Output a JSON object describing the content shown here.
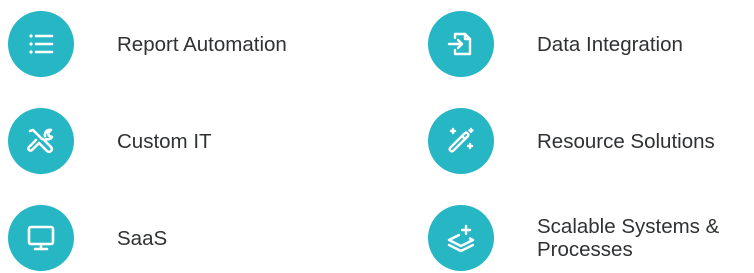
{
  "theme": {
    "accent": "#27b6c4",
    "text": "#2f3133",
    "background": "#ffffff"
  },
  "services": [
    {
      "label": "Report Automation",
      "icon": "list-icon"
    },
    {
      "label": "Data Integration",
      "icon": "import-icon"
    },
    {
      "label": "Custom IT",
      "icon": "tools-icon"
    },
    {
      "label": "Resource Solutions",
      "icon": "magic-wand-icon"
    },
    {
      "label": "SaaS",
      "icon": "monitor-icon"
    },
    {
      "label": "Scalable Systems & Processes",
      "icon": "layers-plus-icon"
    }
  ]
}
